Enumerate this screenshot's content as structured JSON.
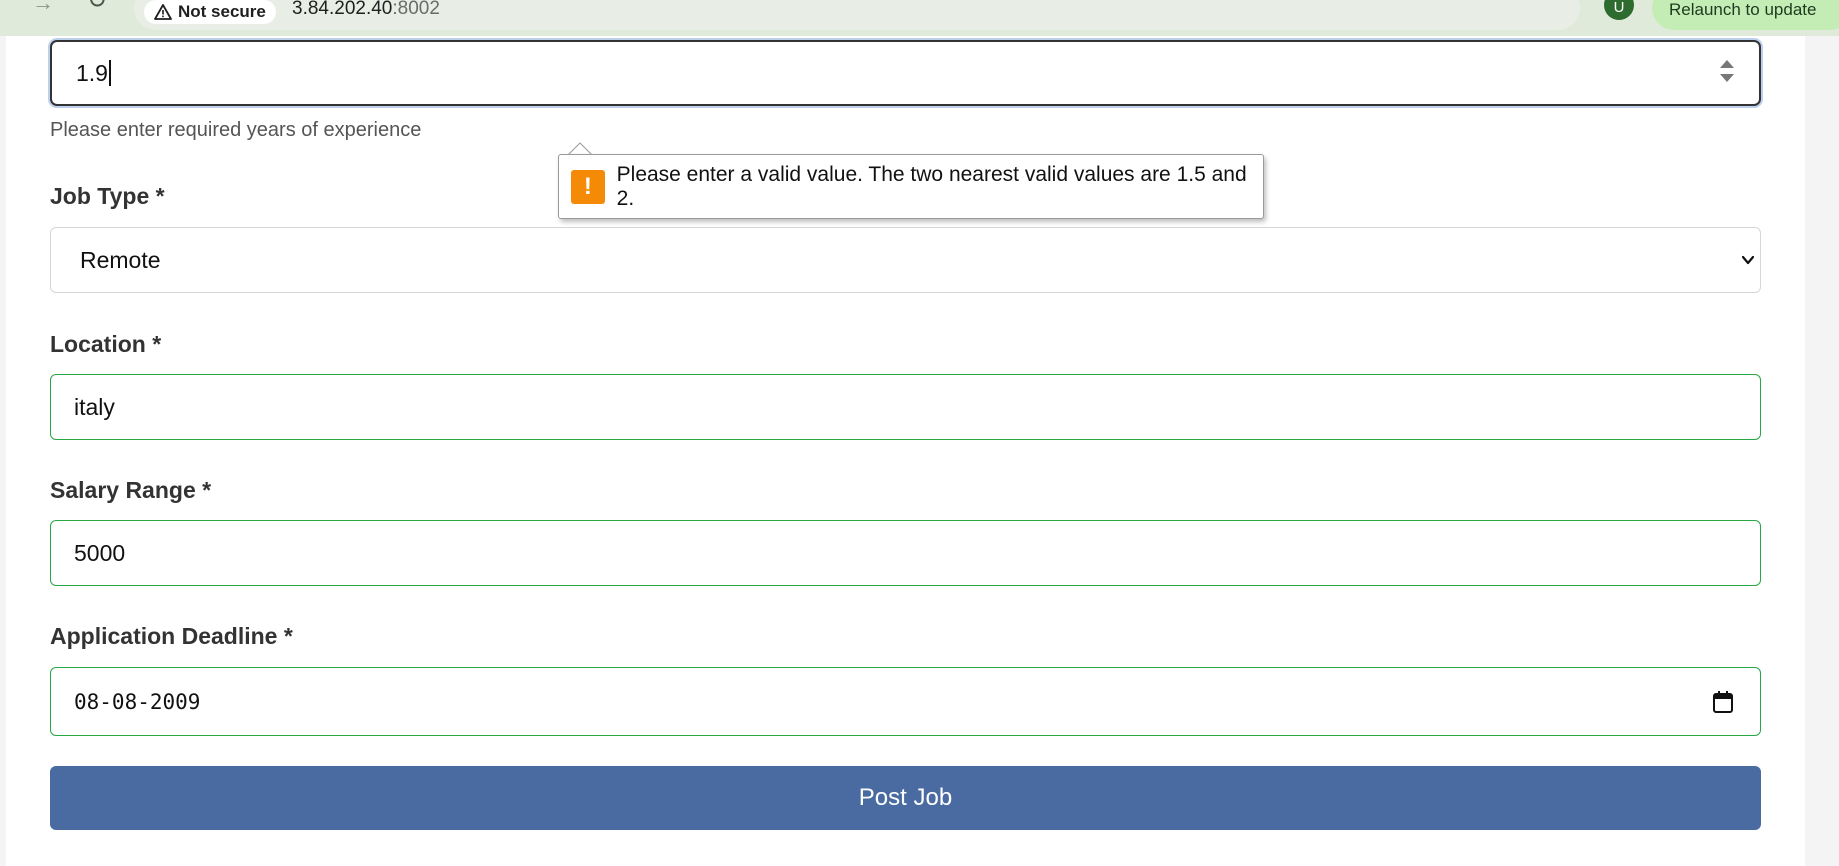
{
  "browser": {
    "security_label": "Not secure",
    "url_host": "3.84.202.40",
    "url_port": ":8002",
    "profile_initial": "U",
    "relaunch_label": "Relaunch to update"
  },
  "form": {
    "experience": {
      "value": "1.9",
      "help": "Please enter required years of experience"
    },
    "validation_message": "Please enter a valid value. The two nearest valid values are 1.5 and 2.",
    "job_type": {
      "label": "Job Type *",
      "selected": "Remote"
    },
    "location": {
      "label": "Location *",
      "value": "italy"
    },
    "salary": {
      "label": "Salary Range *",
      "value": "5000"
    },
    "deadline": {
      "label": "Application Deadline *",
      "value": "08-08-2009"
    },
    "submit_label": "Post Job"
  }
}
